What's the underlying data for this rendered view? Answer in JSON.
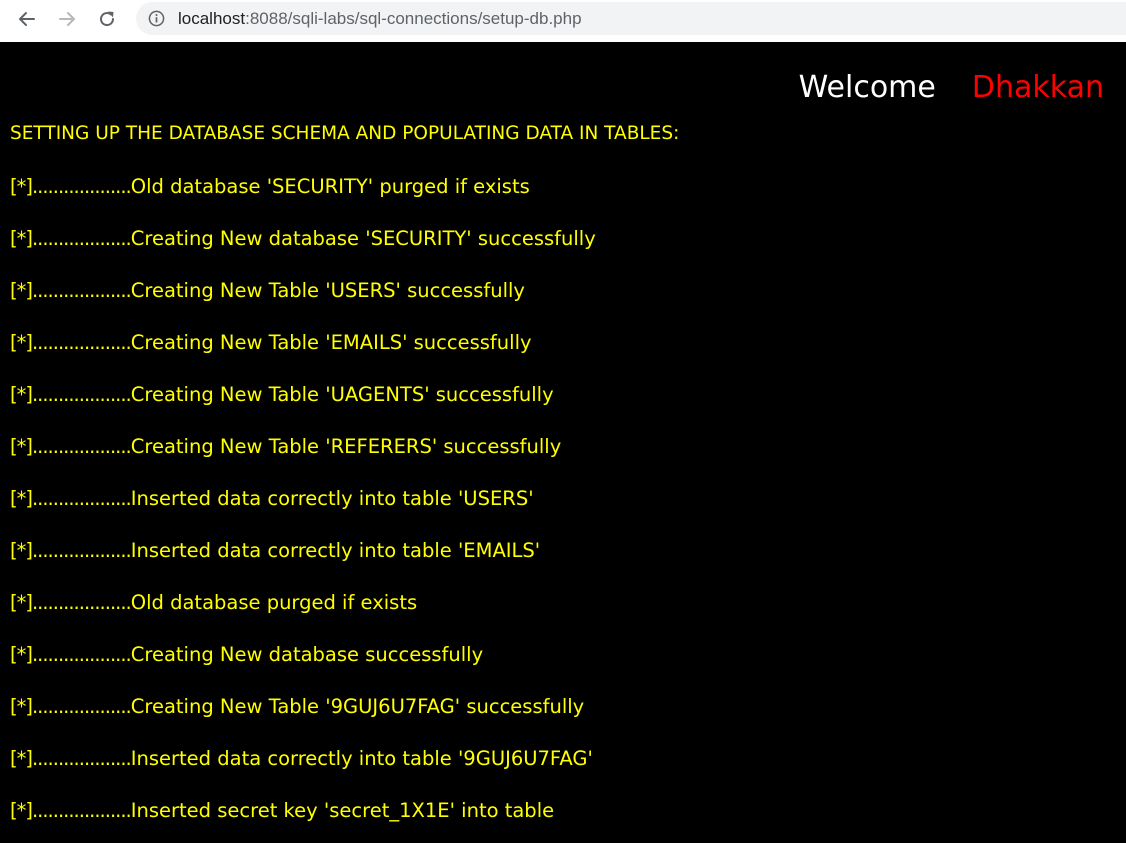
{
  "browser": {
    "url_host": "localhost",
    "url_path": ":8088/sqli-labs/sql-connections/setup-db.php"
  },
  "colors": {
    "page_background": "#000000",
    "text_yellow": "#ffff00",
    "welcome_white": "#ffffff",
    "name_red": "#ff0000"
  },
  "header": {
    "welcome": "Welcome",
    "name": "Dhakkan"
  },
  "heading": "SETTING UP THE DATABASE SCHEMA AND POPULATING DATA IN TABLES:",
  "log": {
    "prefix": "[*]...................",
    "lines": [
      "Old database 'SECURITY' purged if exists",
      "Creating New database 'SECURITY' successfully",
      "Creating New Table 'USERS' successfully",
      "Creating New Table 'EMAILS' successfully",
      "Creating New Table 'UAGENTS' successfully",
      "Creating New Table 'REFERERS' successfully",
      "Inserted data correctly into table 'USERS'",
      "Inserted data correctly into table 'EMAILS'",
      "Old database purged if exists",
      "Creating New database successfully",
      "Creating New Table '9GUJ6U7FAG' successfully",
      "Inserted data correctly into table '9GUJ6U7FAG'",
      "Inserted secret key 'secret_1X1E' into table"
    ]
  }
}
